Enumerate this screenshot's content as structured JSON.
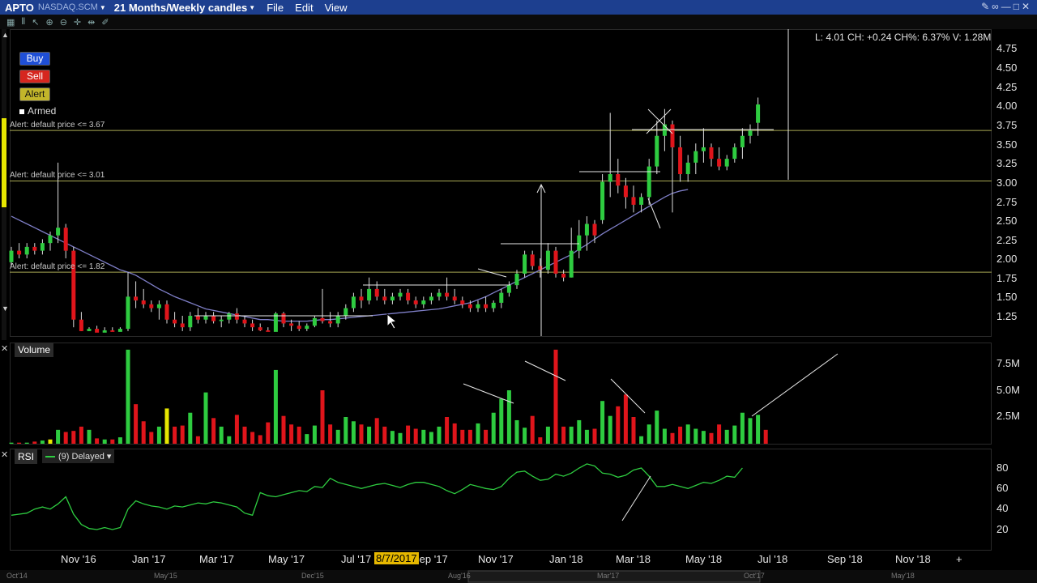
{
  "topbar": {
    "symbol": "APTO",
    "exchange": "NASDAQ.SCM",
    "period": "21 Months/Weekly candles",
    "menu": [
      "File",
      "Edit",
      "View"
    ]
  },
  "order_buttons": {
    "buy": "Buy",
    "sell": "Sell",
    "alert": "Alert",
    "armed": "Armed"
  },
  "alerts": [
    {
      "label": "Alert: default price <= 3.67",
      "price": 3.67
    },
    {
      "label": "Alert: default price <= 3.01",
      "price": 3.01
    },
    {
      "label": "Alert: default price <= 1.82",
      "price": 1.82
    }
  ],
  "info": "L: 4.01 CH: +0.24 CH%: 6.37% V: 1.28M",
  "price_axis": [
    "4.75",
    "4.50",
    "4.25",
    "4.00",
    "3.75",
    "3.50",
    "3.25",
    "3.00",
    "2.75",
    "2.50",
    "2.25",
    "2.00",
    "1.75",
    "1.50",
    "1.25"
  ],
  "volume_pane": {
    "label": "Volume",
    "axis": [
      "7.5M",
      "5.0M",
      "2.5M"
    ]
  },
  "rsi_pane": {
    "label": "RSI",
    "legend": "(9) Delayed",
    "axis": [
      "80",
      "60",
      "40",
      "20"
    ]
  },
  "time_axis": [
    "Nov '16",
    "Jan '17",
    "Mar '17",
    "May '17",
    "Jul '17",
    "Sep '17",
    "Nov '17",
    "Jan '18",
    "Mar '18",
    "May '18",
    "Jul '18",
    "Sep '18",
    "Nov '18"
  ],
  "time_axis_highlight": "8/7/2017",
  "overview_axis": [
    "Oct'14",
    "May'15",
    "Dec'15",
    "Aug'16",
    "Mar'17",
    "Oct'17",
    "May'18"
  ],
  "colors": {
    "up": "#2ecc40",
    "down": "#e0151b",
    "highlight_volume": "#e6e600",
    "ma_line": "#7f7fc8",
    "alert_line": "#a8a854",
    "rsi_line": "#2ecc40",
    "topbar": "#1d3f8f"
  },
  "chart_data": {
    "type": "candlestick",
    "price_ylim": [
      1.0,
      4.85
    ],
    "volume_ylim": [
      0,
      9000000
    ],
    "rsi_ylim": [
      0,
      100
    ],
    "candles": [
      [
        1.95,
        2.15,
        1.9,
        2.1
      ],
      [
        2.1,
        2.2,
        2.0,
        2.05
      ],
      [
        2.05,
        2.2,
        2.0,
        2.15
      ],
      [
        2.15,
        2.2,
        2.05,
        2.1
      ],
      [
        2.1,
        2.25,
        2.05,
        2.2
      ],
      [
        2.2,
        2.35,
        2.1,
        2.3
      ],
      [
        2.3,
        3.25,
        2.2,
        2.4
      ],
      [
        2.4,
        2.45,
        2.0,
        2.1
      ],
      [
        2.1,
        2.15,
        1.1,
        1.2
      ],
      [
        1.2,
        1.3,
        1.0,
        1.05
      ],
      [
        1.05,
        1.1,
        1.0,
        1.08
      ],
      [
        1.08,
        1.12,
        1.0,
        1.03
      ],
      [
        1.03,
        1.1,
        1.0,
        1.06
      ],
      [
        1.06,
        1.1,
        1.0,
        1.04
      ],
      [
        1.04,
        1.1,
        1.0,
        1.08
      ],
      [
        1.08,
        1.82,
        1.05,
        1.5
      ],
      [
        1.5,
        1.7,
        1.35,
        1.45
      ],
      [
        1.45,
        1.6,
        1.35,
        1.4
      ],
      [
        1.4,
        1.45,
        1.3,
        1.35
      ],
      [
        1.35,
        1.45,
        1.2,
        1.4
      ],
      [
        1.4,
        1.45,
        1.15,
        1.2
      ],
      [
        1.2,
        1.3,
        1.1,
        1.15
      ],
      [
        1.15,
        1.25,
        1.05,
        1.1
      ],
      [
        1.1,
        1.3,
        1.05,
        1.25
      ],
      [
        1.25,
        1.35,
        1.15,
        1.2
      ],
      [
        1.2,
        1.3,
        1.15,
        1.25
      ],
      [
        1.25,
        1.3,
        1.15,
        1.18
      ],
      [
        1.18,
        1.25,
        1.1,
        1.2
      ],
      [
        1.2,
        1.3,
        1.15,
        1.28
      ],
      [
        1.28,
        1.35,
        1.15,
        1.2
      ],
      [
        1.2,
        1.25,
        1.1,
        1.15
      ],
      [
        1.15,
        1.2,
        1.05,
        1.1
      ],
      [
        1.1,
        1.15,
        1.02,
        1.06
      ],
      [
        1.06,
        1.1,
        1.0,
        1.04
      ],
      [
        1.04,
        1.3,
        1.0,
        1.28
      ],
      [
        1.28,
        1.3,
        1.1,
        1.15
      ],
      [
        1.15,
        1.2,
        1.05,
        1.12
      ],
      [
        1.12,
        1.18,
        1.05,
        1.08
      ],
      [
        1.08,
        1.15,
        1.05,
        1.12
      ],
      [
        1.12,
        1.25,
        1.1,
        1.22
      ],
      [
        1.22,
        1.6,
        1.15,
        1.18
      ],
      [
        1.18,
        1.3,
        1.1,
        1.15
      ],
      [
        1.15,
        1.3,
        1.1,
        1.25
      ],
      [
        1.25,
        1.4,
        1.2,
        1.35
      ],
      [
        1.35,
        1.55,
        1.3,
        1.5
      ],
      [
        1.5,
        1.6,
        1.35,
        1.45
      ],
      [
        1.45,
        1.75,
        1.4,
        1.6
      ],
      [
        1.6,
        1.7,
        1.45,
        1.5
      ],
      [
        1.5,
        1.6,
        1.4,
        1.45
      ],
      [
        1.45,
        1.55,
        1.4,
        1.5
      ],
      [
        1.5,
        1.6,
        1.45,
        1.55
      ],
      [
        1.55,
        1.6,
        1.4,
        1.45
      ],
      [
        1.45,
        1.5,
        1.35,
        1.4
      ],
      [
        1.4,
        1.5,
        1.35,
        1.45
      ],
      [
        1.45,
        1.55,
        1.4,
        1.5
      ],
      [
        1.5,
        1.6,
        1.45,
        1.55
      ],
      [
        1.55,
        1.75,
        1.45,
        1.5
      ],
      [
        1.5,
        1.6,
        1.4,
        1.45
      ],
      [
        1.45,
        1.5,
        1.35,
        1.4
      ],
      [
        1.4,
        1.45,
        1.3,
        1.35
      ],
      [
        1.35,
        1.45,
        1.3,
        1.4
      ],
      [
        1.4,
        1.5,
        1.3,
        1.35
      ],
      [
        1.35,
        1.45,
        1.3,
        1.42
      ],
      [
        1.42,
        1.6,
        1.35,
        1.55
      ],
      [
        1.55,
        1.7,
        1.5,
        1.65
      ],
      [
        1.65,
        1.85,
        1.6,
        1.8
      ],
      [
        1.8,
        2.1,
        1.75,
        2.05
      ],
      [
        2.05,
        2.1,
        1.85,
        1.9
      ],
      [
        1.9,
        2.0,
        1.75,
        1.85
      ],
      [
        1.85,
        2.2,
        1.8,
        2.1
      ],
      [
        2.1,
        2.15,
        1.75,
        1.8
      ],
      [
        1.8,
        1.85,
        1.7,
        1.75
      ],
      [
        1.75,
        2.4,
        1.75,
        2.1
      ],
      [
        2.1,
        2.5,
        2.0,
        2.3
      ],
      [
        2.3,
        2.55,
        2.1,
        2.45
      ],
      [
        2.45,
        2.5,
        2.2,
        2.3
      ],
      [
        2.5,
        3.1,
        2.45,
        3.0
      ],
      [
        3.0,
        3.9,
        2.8,
        3.1
      ],
      [
        3.1,
        3.3,
        2.85,
        2.95
      ],
      [
        2.95,
        3.05,
        2.65,
        2.8
      ],
      [
        2.8,
        2.95,
        2.6,
        2.7
      ],
      [
        2.7,
        2.85,
        2.6,
        2.8
      ],
      [
        2.8,
        3.3,
        2.7,
        3.2
      ],
      [
        3.2,
        3.8,
        3.1,
        3.6
      ],
      [
        3.6,
        3.95,
        3.4,
        3.75
      ],
      [
        3.75,
        3.8,
        2.6,
        3.45
      ],
      [
        3.45,
        3.6,
        3.0,
        3.1
      ],
      [
        3.1,
        3.35,
        3.0,
        3.25
      ],
      [
        3.25,
        3.5,
        3.1,
        3.4
      ],
      [
        3.4,
        3.7,
        3.25,
        3.45
      ],
      [
        3.45,
        3.5,
        3.2,
        3.3
      ],
      [
        3.3,
        3.45,
        3.15,
        3.2
      ],
      [
        3.2,
        3.35,
        3.15,
        3.3
      ],
      [
        3.3,
        3.5,
        3.25,
        3.45
      ],
      [
        3.45,
        3.7,
        3.3,
        3.6
      ],
      [
        3.6,
        3.75,
        3.5,
        3.67
      ],
      [
        3.77,
        4.1,
        3.6,
        4.01
      ]
    ],
    "volume": [
      0.1,
      0.1,
      0.1,
      0.2,
      0.3,
      0.4,
      1.3,
      1.1,
      1.2,
      1.6,
      1.3,
      0.5,
      0.4,
      0.4,
      0.6,
      8.8,
      3.7,
      2.1,
      1.1,
      1.6,
      3.3,
      1.6,
      1.7,
      2.9,
      0.7,
      4.8,
      2.4,
      1.6,
      0.7,
      2.7,
      1.6,
      1.1,
      0.8,
      2.0,
      6.9,
      2.6,
      1.8,
      1.6,
      0.9,
      1.7,
      5.0,
      1.8,
      1.3,
      2.5,
      2.1,
      1.8,
      1.6,
      2.4,
      1.6,
      1.2,
      1.0,
      1.7,
      1.4,
      1.3,
      1.1,
      1.6,
      2.5,
      1.9,
      1.3,
      1.3,
      1.9,
      1.3,
      2.9,
      4.2,
      5.0,
      2.2,
      1.5,
      2.6,
      0.6,
      1.6,
      8.8,
      1.6,
      1.6,
      2.2,
      1.3,
      1.4,
      4.0,
      2.6,
      3.5,
      4.6,
      2.5,
      0.7,
      1.8,
      3.1,
      1.4,
      1.0,
      1.6,
      1.8,
      1.4,
      1.2,
      1.0,
      1.8,
      1.3,
      1.7,
      2.9,
      2.4,
      2.7,
      1.3
    ],
    "volume_highlight": [
      5,
      20
    ],
    "rsi": [
      34,
      35,
      36,
      40,
      42,
      40,
      45,
      52,
      35,
      25,
      21,
      20,
      22,
      20,
      22,
      40,
      48,
      45,
      43,
      42,
      40,
      43,
      42,
      44,
      46,
      45,
      47,
      46,
      44,
      42,
      36,
      34,
      56,
      53,
      52,
      54,
      56,
      58,
      57,
      62,
      61,
      70,
      66,
      64,
      62,
      60,
      62,
      64,
      65,
      63,
      61,
      64,
      66,
      66,
      64,
      62,
      58,
      55,
      59,
      64,
      62,
      60,
      59,
      62,
      70,
      76,
      77,
      72,
      68,
      69,
      74,
      72,
      75,
      80,
      84,
      82,
      75,
      74,
      71,
      73,
      78,
      80,
      72,
      62,
      62,
      64,
      62,
      60,
      63,
      66,
      65,
      68,
      72,
      71,
      80
    ],
    "ma": [
      2.55,
      2.5,
      2.45,
      2.4,
      2.35,
      2.3,
      2.25,
      2.2,
      2.15,
      2.1,
      2.05,
      2.0,
      1.95,
      1.9,
      1.85,
      1.82,
      1.78,
      1.72,
      1.66,
      1.6,
      1.55,
      1.5,
      1.46,
      1.42,
      1.38,
      1.34,
      1.32,
      1.3,
      1.28,
      1.26,
      1.24,
      1.22,
      1.2,
      1.2,
      1.19,
      1.18,
      1.18,
      1.18,
      1.18,
      1.19,
      1.2,
      1.2,
      1.21,
      1.22,
      1.23,
      1.24,
      1.25,
      1.26,
      1.27,
      1.28,
      1.29,
      1.3,
      1.31,
      1.32,
      1.33,
      1.34,
      1.36,
      1.38,
      1.4,
      1.42,
      1.46,
      1.5,
      1.55,
      1.6,
      1.65,
      1.7,
      1.75,
      1.8,
      1.85,
      1.9,
      1.95,
      2.0,
      2.05,
      2.12,
      2.18,
      2.25,
      2.32,
      2.38,
      2.44,
      2.5,
      2.56,
      2.62,
      2.68,
      2.74,
      2.8,
      2.85,
      2.88,
      2.9
    ]
  }
}
